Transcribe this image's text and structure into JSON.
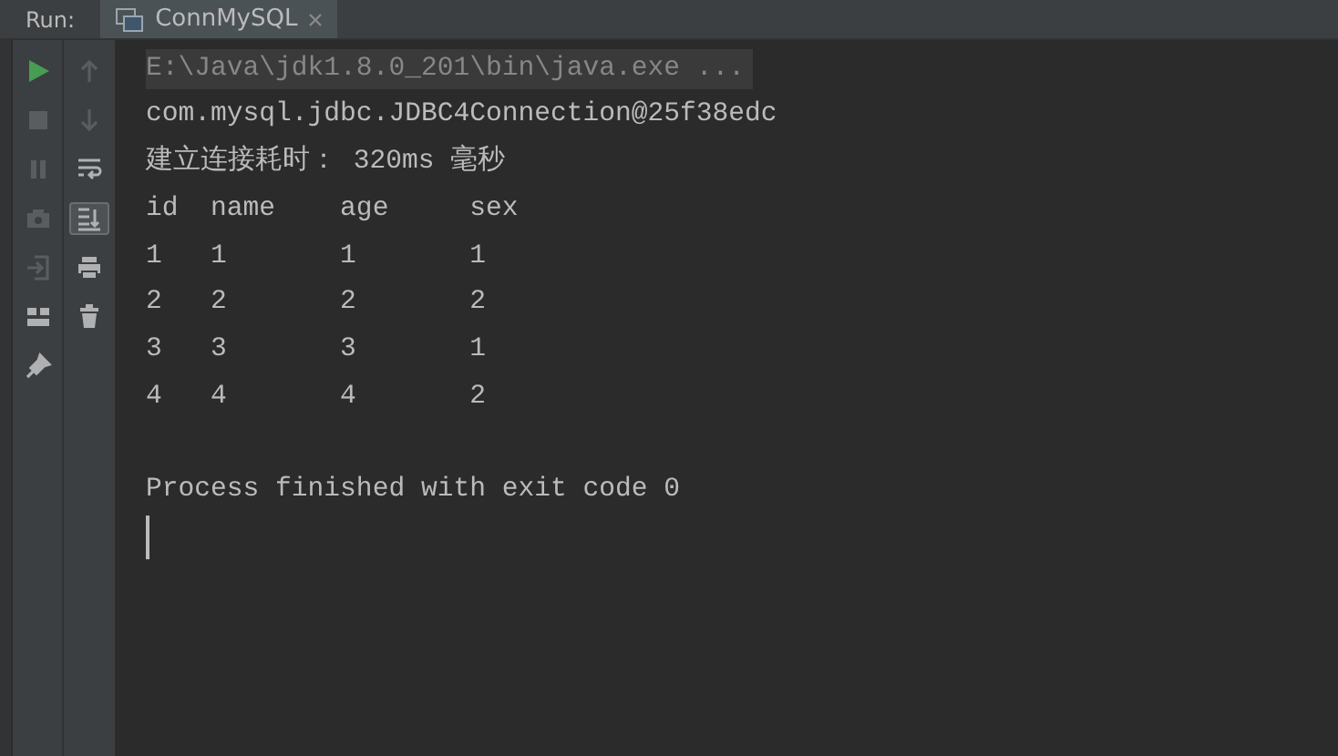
{
  "run_label": "Run:",
  "tabs": [
    {
      "label": "ConnMySQL",
      "selected": true
    }
  ],
  "toolbar_left": [
    {
      "kind": "run",
      "disabled": false
    },
    {
      "kind": "stop",
      "disabled": true
    },
    {
      "kind": "pause",
      "disabled": true
    },
    {
      "kind": "camera",
      "disabled": true
    },
    {
      "kind": "exit",
      "disabled": true
    },
    {
      "kind": "layout",
      "disabled": false
    },
    {
      "kind": "pin",
      "disabled": false
    }
  ],
  "toolbar_right": [
    {
      "kind": "up",
      "selected": false,
      "disabled": true
    },
    {
      "kind": "down",
      "selected": false,
      "disabled": true
    },
    {
      "kind": "wrap",
      "selected": false,
      "disabled": false
    },
    {
      "kind": "scroll_end",
      "selected": true,
      "disabled": false
    },
    {
      "kind": "print",
      "selected": false,
      "disabled": false
    },
    {
      "kind": "trash",
      "selected": false,
      "disabled": false
    }
  ],
  "console_lines": [
    {
      "kind": "command",
      "text": "E:\\Java\\jdk1.8.0_201\\bin\\java.exe ..."
    },
    {
      "kind": "output",
      "text": "com.mysql.jdbc.JDBC4Connection@25f38edc"
    },
    {
      "kind": "output",
      "text": "建立连接耗时： 320ms 毫秒"
    },
    {
      "kind": "output",
      "text": "id  name    age     sex"
    },
    {
      "kind": "output",
      "text": "1   1       1       1"
    },
    {
      "kind": "output",
      "text": "2   2       2       2"
    },
    {
      "kind": "output",
      "text": "3   3       3       1"
    },
    {
      "kind": "output",
      "text": "4   4       4       2"
    },
    {
      "kind": "blank"
    },
    {
      "kind": "output",
      "text": "Process finished with exit code 0"
    }
  ]
}
